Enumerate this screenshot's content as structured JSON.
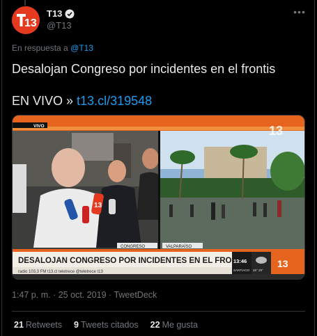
{
  "author": {
    "display_name": "T13",
    "handle": "@T13",
    "avatar_text": "13"
  },
  "reply": {
    "prefix": "En respuesta a",
    "handle": "@T13"
  },
  "tweet": {
    "line1": "Desalojan Congreso por incidentes en el frontis",
    "line2_prefix": "EN VIVO »",
    "link": "t13.cl/319548"
  },
  "media": {
    "live_badge": "VIVO",
    "logo_text": "13",
    "left_label": "CONGRESO",
    "right_label": "VALPARAÍSO",
    "headline": "DESALOJAN CONGRESO POR INCIDENTES EN EL FRONTIS",
    "ticker": "radio 103,3 FM   t13.cl   teletrece   @teletrece   t13",
    "clock": "13:46",
    "city": "SANTIAGO",
    "temps": "26° 29°"
  },
  "meta": {
    "time": "1:47 p. m.",
    "separator": "·",
    "date": "25 oct. 2019",
    "source": "TweetDeck"
  },
  "stats": [
    {
      "count": "21",
      "label": "Retweets"
    },
    {
      "count": "9",
      "label": "Tweets citados"
    },
    {
      "count": "22",
      "label": "Me gusta"
    }
  ],
  "colors": {
    "link": "#1d9bf0",
    "brand_red": "#e53a1f",
    "secondary_text": "#71767b"
  }
}
